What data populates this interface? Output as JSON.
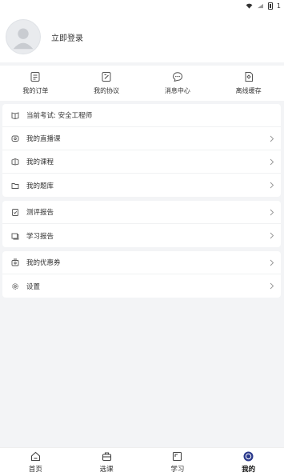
{
  "status_bar": {
    "battery_text": "1"
  },
  "profile": {
    "login_label": "立即登录"
  },
  "quick_nav": [
    {
      "label": "我的订单",
      "icon": "order-icon"
    },
    {
      "label": "我的协议",
      "icon": "agreement-icon"
    },
    {
      "label": "消息中心",
      "icon": "message-icon"
    },
    {
      "label": "离线缓存",
      "icon": "cache-icon"
    }
  ],
  "group1": {
    "current_exam": "当前考试: 安全工程师",
    "items": [
      "我的直播课",
      "我的课程",
      "我的题库"
    ]
  },
  "group2": {
    "items": [
      "测评报告",
      "学习报告"
    ]
  },
  "group3": {
    "items": [
      "我的优惠券",
      "设置"
    ]
  },
  "tabs": [
    {
      "label": "首页",
      "icon": "home-icon"
    },
    {
      "label": "选课",
      "icon": "course-select-icon"
    },
    {
      "label": "学习",
      "icon": "study-icon"
    },
    {
      "label": "我的",
      "icon": "profile-icon",
      "active": true
    }
  ],
  "colors": {
    "background": "#f3f4f6",
    "card": "#ffffff",
    "icon": "#555555",
    "active_tab": "#2b3a8c"
  }
}
